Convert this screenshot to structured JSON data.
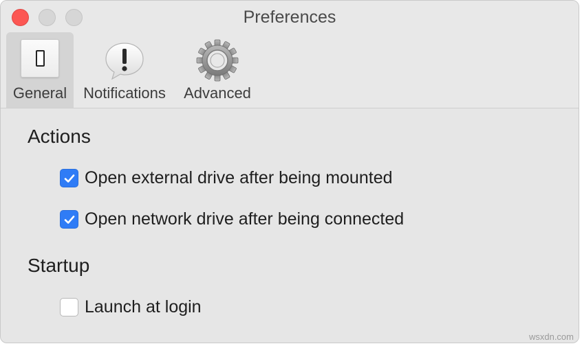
{
  "window": {
    "title": "Preferences"
  },
  "toolbar": {
    "tabs": [
      {
        "id": "general",
        "label": "General",
        "icon": "toggle-switch-icon",
        "selected": true
      },
      {
        "id": "notifications",
        "label": "Notifications",
        "icon": "exclamation-bubble-icon",
        "selected": false
      },
      {
        "id": "advanced",
        "label": "Advanced",
        "icon": "gear-icon",
        "selected": false
      }
    ]
  },
  "sections": {
    "actions": {
      "heading": "Actions",
      "options": [
        {
          "label": "Open external drive after being mounted",
          "checked": true
        },
        {
          "label": "Open network drive after being connected",
          "checked": true
        }
      ]
    },
    "startup": {
      "heading": "Startup",
      "options": [
        {
          "label": "Launch at login",
          "checked": false
        }
      ]
    }
  },
  "colors": {
    "accent": "#2f7cf6",
    "close": "#fc5753",
    "background": "#e6e6e6"
  },
  "watermark": "wsxdn.com"
}
